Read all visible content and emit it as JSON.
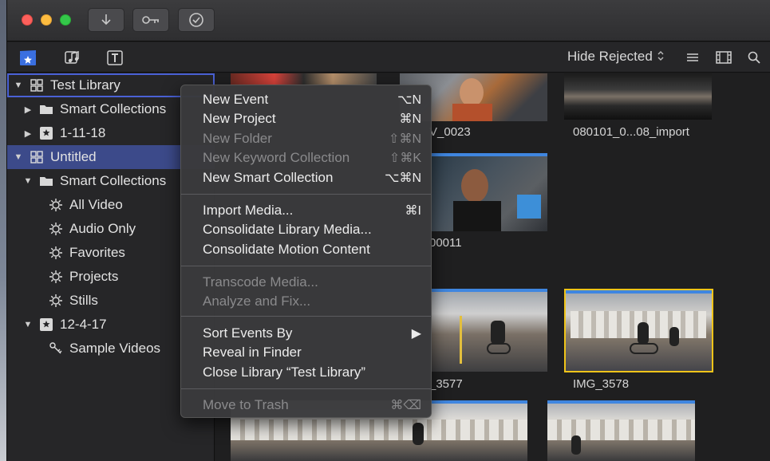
{
  "titlebar": {
    "buttons": [
      "import-arrow",
      "keywords-key",
      "checkmark"
    ]
  },
  "toolbar": {
    "filter_label": "Hide Rejected",
    "filter_chevron": "⌃⌄"
  },
  "sidebar": {
    "items": [
      {
        "label": "Test Library",
        "icon": "library-grid-icon",
        "triangle": "▼"
      },
      {
        "label": "Smart Collections",
        "icon": "folder-icon",
        "triangle": "▶"
      },
      {
        "label": "1-11-18",
        "icon": "event-star-icon",
        "triangle": "▶"
      },
      {
        "label": "Untitled",
        "icon": "library-grid-icon",
        "triangle": "▼"
      },
      {
        "label": "Smart Collections",
        "icon": "folder-icon",
        "triangle": "▼"
      },
      {
        "label": "All Video",
        "icon": "gear-icon",
        "triangle": ""
      },
      {
        "label": "Audio Only",
        "icon": "gear-icon",
        "triangle": ""
      },
      {
        "label": "Favorites",
        "icon": "gear-icon",
        "triangle": ""
      },
      {
        "label": "Projects",
        "icon": "gear-icon",
        "triangle": ""
      },
      {
        "label": "Stills",
        "icon": "gear-icon",
        "triangle": ""
      },
      {
        "label": "12-4-17",
        "icon": "event-star-icon",
        "triangle": "▼"
      },
      {
        "label": "Sample Videos",
        "icon": "key-icon",
        "triangle": ""
      }
    ]
  },
  "browser": {
    "clips": [
      {
        "caption": "V_0023"
      },
      {
        "caption": "080101_0...08_import"
      },
      {
        "caption": "00011"
      },
      {
        "caption": "_3577"
      },
      {
        "caption": "IMG_3578"
      }
    ]
  },
  "menu": {
    "items": [
      {
        "label": "New Event",
        "shortcut": "⌥N",
        "enabled": true
      },
      {
        "label": "New Project",
        "shortcut": "⌘N",
        "enabled": true
      },
      {
        "label": "New Folder",
        "shortcut": "⇧⌘N",
        "enabled": false
      },
      {
        "label": "New Keyword Collection",
        "shortcut": "⇧⌘K",
        "enabled": false
      },
      {
        "label": "New Smart Collection",
        "shortcut": "⌥⌘N",
        "enabled": true
      },
      {
        "label": "Import Media...",
        "shortcut": "⌘I",
        "enabled": true
      },
      {
        "label": "Consolidate Library Media...",
        "shortcut": "",
        "enabled": true
      },
      {
        "label": "Consolidate Motion Content",
        "shortcut": "",
        "enabled": true
      },
      {
        "label": "Transcode Media...",
        "shortcut": "",
        "enabled": false
      },
      {
        "label": "Analyze and Fix...",
        "shortcut": "",
        "enabled": false
      },
      {
        "label": "Sort Events By",
        "shortcut": "▶",
        "enabled": true
      },
      {
        "label": "Reveal in Finder",
        "shortcut": "",
        "enabled": true
      },
      {
        "label": "Close Library “Test Library”",
        "shortcut": "",
        "enabled": true
      },
      {
        "label": "Move to Trash",
        "shortcut": "⌘⌫",
        "enabled": false
      }
    ]
  },
  "colors": {
    "selection": "#3c4a8a",
    "accent_blue": "#3f86e0",
    "selected_clip_border": "#f0c419"
  }
}
